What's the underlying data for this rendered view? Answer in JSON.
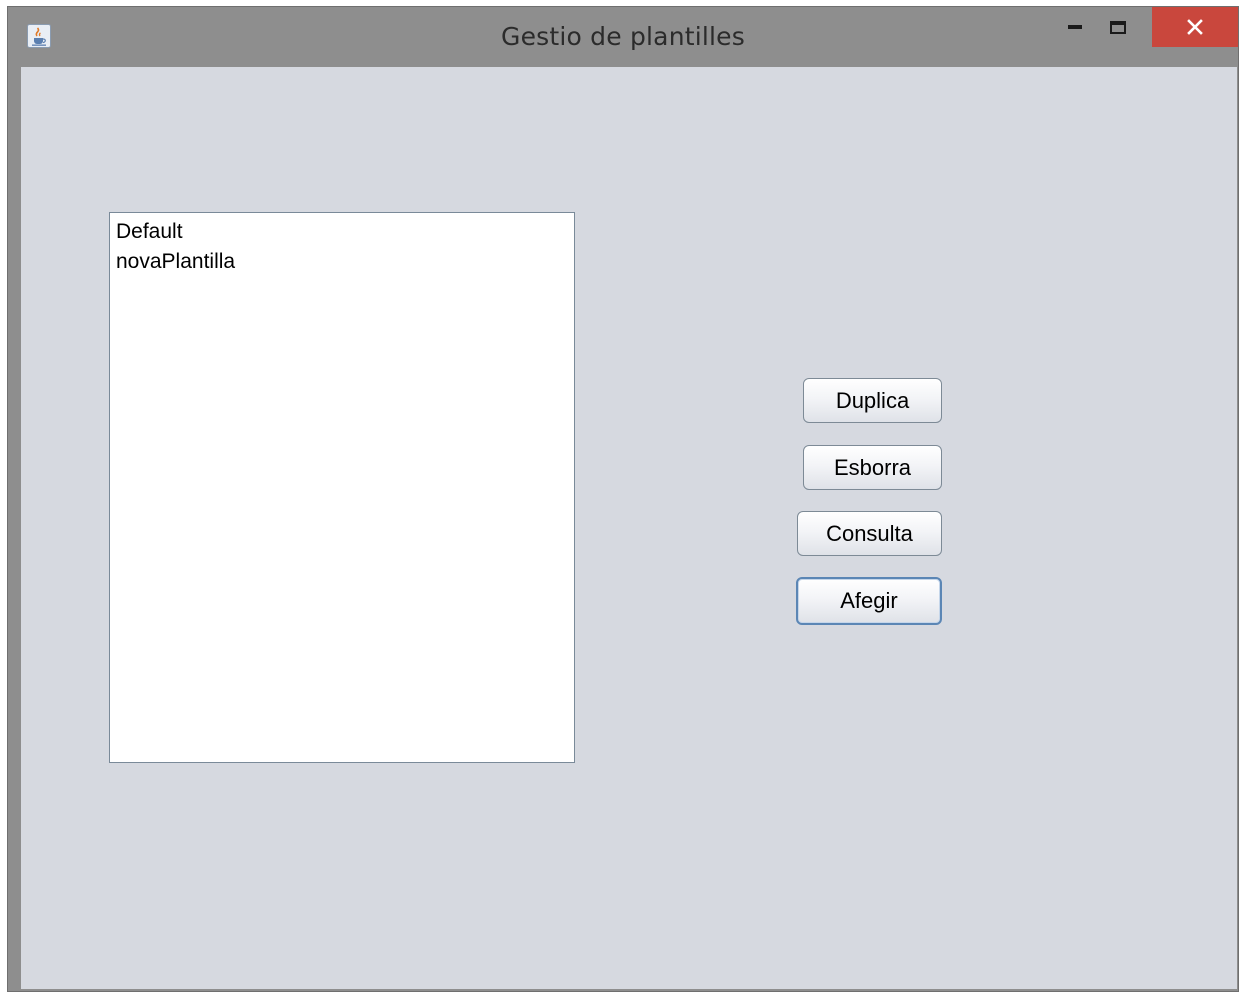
{
  "window": {
    "title": "Gestio de plantilles",
    "controls": {
      "minimize_icon": "minimize-icon",
      "maximize_icon": "maximize-icon",
      "close_icon": "close-icon",
      "close_color": "#c9473d"
    },
    "app_icon": "java-cup-icon"
  },
  "templates_list": {
    "items": [
      "Default",
      "novaPlantilla"
    ]
  },
  "buttons": {
    "duplicate": "Duplica",
    "delete": "Esborra",
    "consult": "Consulta",
    "add": "Afegir"
  },
  "colors": {
    "frame": "#8e8e8e",
    "client_background": "#d6d9e0",
    "list_background": "#ffffff",
    "focus_border": "#5b86b5"
  }
}
